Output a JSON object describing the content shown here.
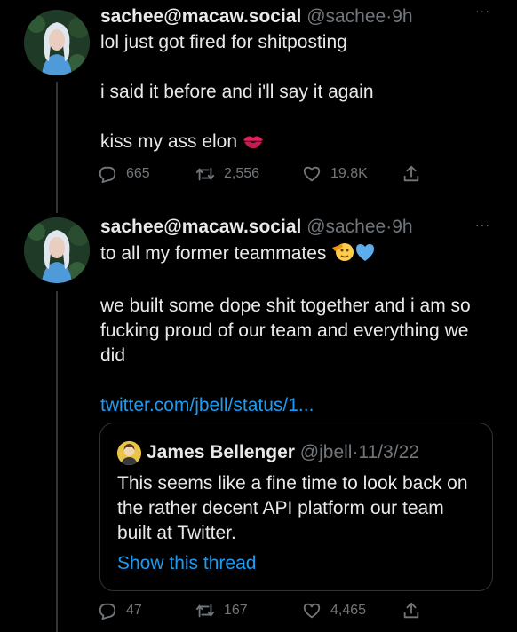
{
  "colors": {
    "background": "#000000",
    "text_primary": "#e7e9ea",
    "text_secondary": "#71767b",
    "link": "#1d9bf0",
    "border": "#2f3336"
  },
  "tweets": [
    {
      "display_name": "sachee@macaw.social",
      "handle": "@sachee",
      "separator": "·",
      "time": "9h",
      "menu": "···",
      "lines": [
        "lol just got fired for shitposting",
        "i said it before and i'll say it again",
        "kiss my ass elon"
      ],
      "emoji": "kiss-mark",
      "stats": {
        "replies": "665",
        "retweets": "2,556",
        "likes": "19.8K"
      }
    },
    {
      "display_name": "sachee@macaw.social",
      "handle": "@sachee",
      "separator": "·",
      "time": "9h",
      "menu": "···",
      "line1": "to all my former teammates",
      "emoji": [
        "saluting-face",
        "blue-heart"
      ],
      "line2": "we built some dope shit together and i am so fucking proud of our team and everything we did",
      "link": "twitter.com/jbell/status/1...",
      "quote": {
        "name": "James Bellenger",
        "handle": "@jbell",
        "separator": "·",
        "date": "11/3/22",
        "text": "This seems like a fine time to look back on the rather decent API platform our team built at Twitter.",
        "show_thread": "Show this thread"
      },
      "stats": {
        "replies": "47",
        "retweets": "167",
        "likes": "4,465"
      }
    }
  ]
}
